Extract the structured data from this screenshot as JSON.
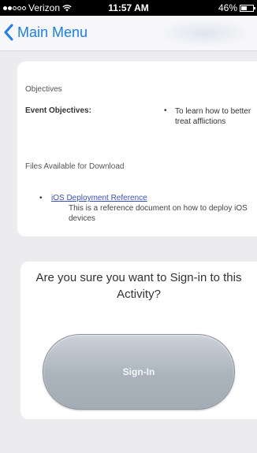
{
  "status_bar": {
    "carrier": "Verizon",
    "time": "11:57 AM",
    "battery": "46%"
  },
  "nav": {
    "back_label": "Main Menu"
  },
  "details": {
    "objectives_title": "Objectives",
    "event_objectives_label": "Event Objectives:",
    "event_objectives_items": [
      "To learn how to better treat afflictions"
    ],
    "files_title": "Files Available for Download",
    "files": [
      {
        "name": "iOS Deployment Reference",
        "description": "This is a reference document on how to deploy iOS devices"
      }
    ]
  },
  "signin": {
    "question": "Are you sure you want to Sign-in to this Activity?",
    "button_label": "Sign-In"
  },
  "colors": {
    "link_blue": "#1a7ef5",
    "button_gray": "#aab3bc",
    "background": "#ececef"
  }
}
